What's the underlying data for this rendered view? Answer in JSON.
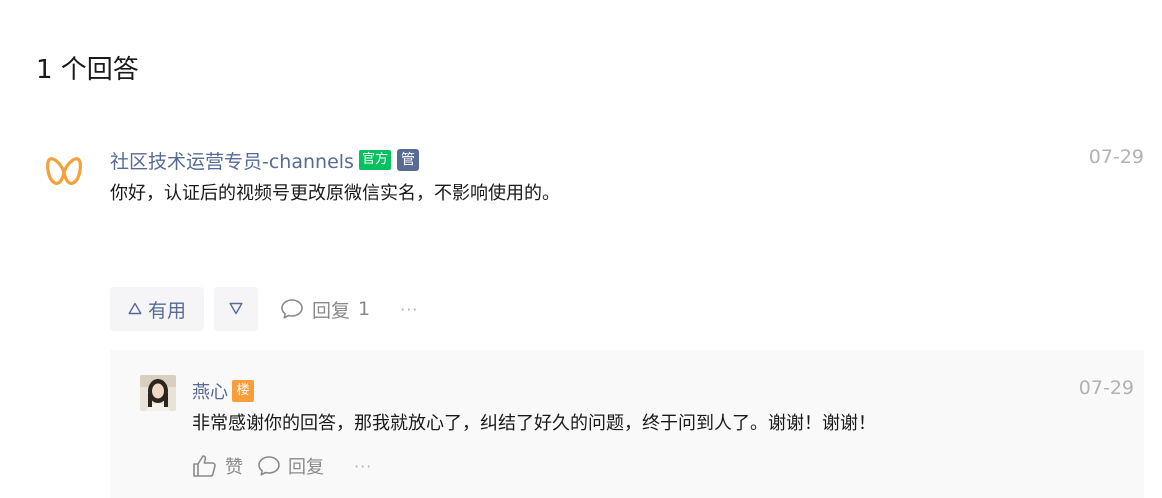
{
  "answers_count_title": "1 个回答",
  "answer": {
    "author": "社区技术运营专员-channels",
    "badge_official": "官方",
    "badge_admin": "管",
    "date": "07-29",
    "content": "你好，认证后的视频号更改原微信实名，不影响使用的。",
    "avatar_icon": "channels-logo-icon",
    "accent_color": "#f5a03a",
    "useful_label": "有用",
    "reply_label": "回复",
    "reply_count": "1",
    "more_label": "···"
  },
  "reply": {
    "author": "燕心",
    "badge_floor": "楼",
    "date": "07-29",
    "content": "非常感谢你的回答，那我就放心了，纠结了好久的问题，终于问到人了。谢谢！谢谢！",
    "like_label": "赞",
    "reply_label": "回复",
    "more_label": "···"
  },
  "colors": {
    "link": "#576b95",
    "official_badge": "#07c160",
    "floor_badge": "#fa9d3b",
    "muted": "#b2b2b2"
  }
}
